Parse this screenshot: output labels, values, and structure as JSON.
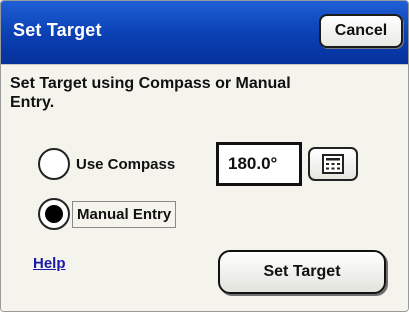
{
  "dialog": {
    "title": "Set Target",
    "cancel_label": "Cancel",
    "instruction": "Set Target using Compass or Manual Entry.",
    "options": [
      {
        "label": "Use Compass",
        "selected": false
      },
      {
        "label": "Manual Entry",
        "selected": true
      }
    ],
    "value": "180.0°",
    "keypad_icon": "keypad-icon",
    "help_label": "Help",
    "set_target_label": "Set Target"
  },
  "colors": {
    "titlebar": "#0a3fb3",
    "background": "#f4f3ec",
    "link": "#1a1aa6"
  }
}
